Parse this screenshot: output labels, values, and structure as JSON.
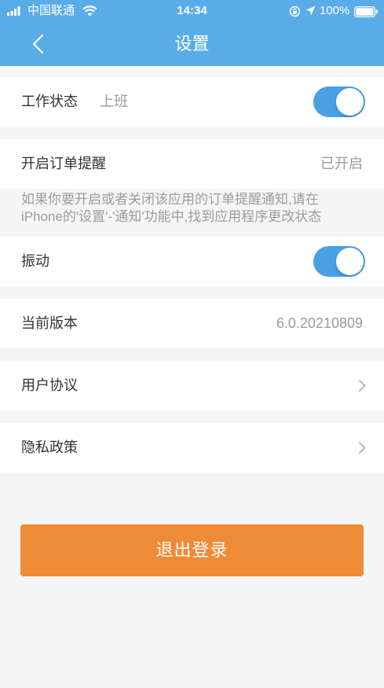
{
  "status_bar": {
    "carrier": "中国联通",
    "time": "14:34",
    "battery": "100%",
    "icons": [
      "signal-icon",
      "wifi-icon",
      "orientation-lock-icon",
      "location-icon",
      "battery-icon"
    ]
  },
  "nav": {
    "title": "设置",
    "back_icon": "chevron-left-icon"
  },
  "settings": {
    "work_status": {
      "label": "工作状态",
      "value": "上班",
      "toggle_on": true
    },
    "order_reminder": {
      "label": "开启订单提醒",
      "value": "已开启"
    },
    "hint": [
      "如果你要开启或者关闭该应用的订单提醒通知,请在",
      "iPhone的'设置'-'通知'功能中,找到应用程序更改状态"
    ],
    "vibration": {
      "label": "振动",
      "toggle_on": true
    },
    "version": {
      "label": "当前版本",
      "value": "6.0.20210809"
    },
    "user_agreement": {
      "label": "用户协议",
      "icon": "chevron-right-icon"
    },
    "privacy_policy": {
      "label": "隐私政策",
      "icon": "chevron-right-icon"
    }
  },
  "logout": {
    "label": "退出登录"
  },
  "colors": {
    "header_bg": "#5aace8",
    "toggle_on": "#4aa0e5",
    "logout_button": "#ef8a36",
    "page_bg": "#f5f5f5"
  }
}
